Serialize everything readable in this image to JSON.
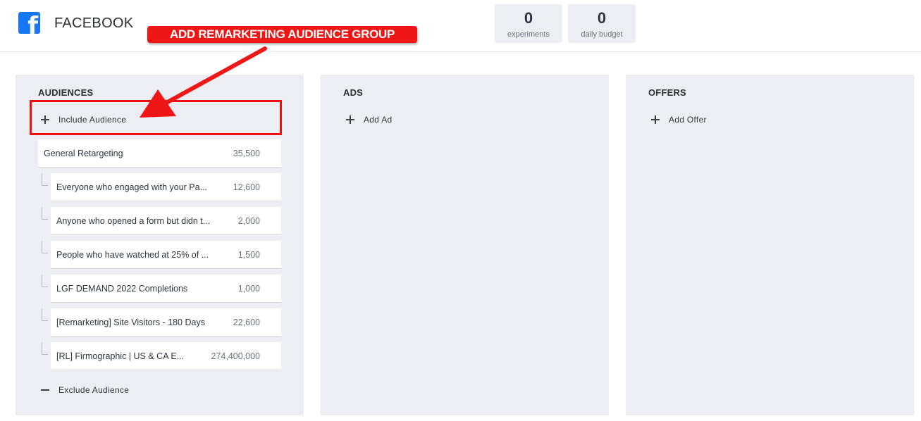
{
  "header": {
    "title": "FACEBOOK",
    "logo_letter": "f",
    "stats": [
      {
        "value": "0",
        "label": "experiments"
      },
      {
        "value": "0",
        "label": "daily budget"
      }
    ]
  },
  "annotation": {
    "label": "ADD REMARKETING AUDIENCE GROUP",
    "color": "#f01616"
  },
  "audiences": {
    "title": "AUDIENCES",
    "include_label": "Include Audience",
    "exclude_label": "Exclude Audience",
    "group": {
      "name": "General Retargeting",
      "count": "35,500"
    },
    "items": [
      {
        "name": "Everyone who engaged with your Pa...",
        "count": "12,600"
      },
      {
        "name": "Anyone who opened a form but didn t...",
        "count": "2,000"
      },
      {
        "name": "People who have watched at 25% of ...",
        "count": "1,500"
      },
      {
        "name": "LGF DEMAND 2022 Completions",
        "count": "1,000"
      },
      {
        "name": "[Remarketing] Site Visitors - 180 Days",
        "count": "22,600"
      },
      {
        "name": "[RL] Firmographic | US & CA E...",
        "count": "274,400,000"
      }
    ]
  },
  "ads": {
    "title": "ADS",
    "add_label": "Add Ad"
  },
  "offers": {
    "title": "OFFERS",
    "add_label": "Add Offer"
  },
  "colors": {
    "brand": "#1877f2",
    "panel_bg": "#eceef3",
    "annotation_red": "#f01616"
  }
}
